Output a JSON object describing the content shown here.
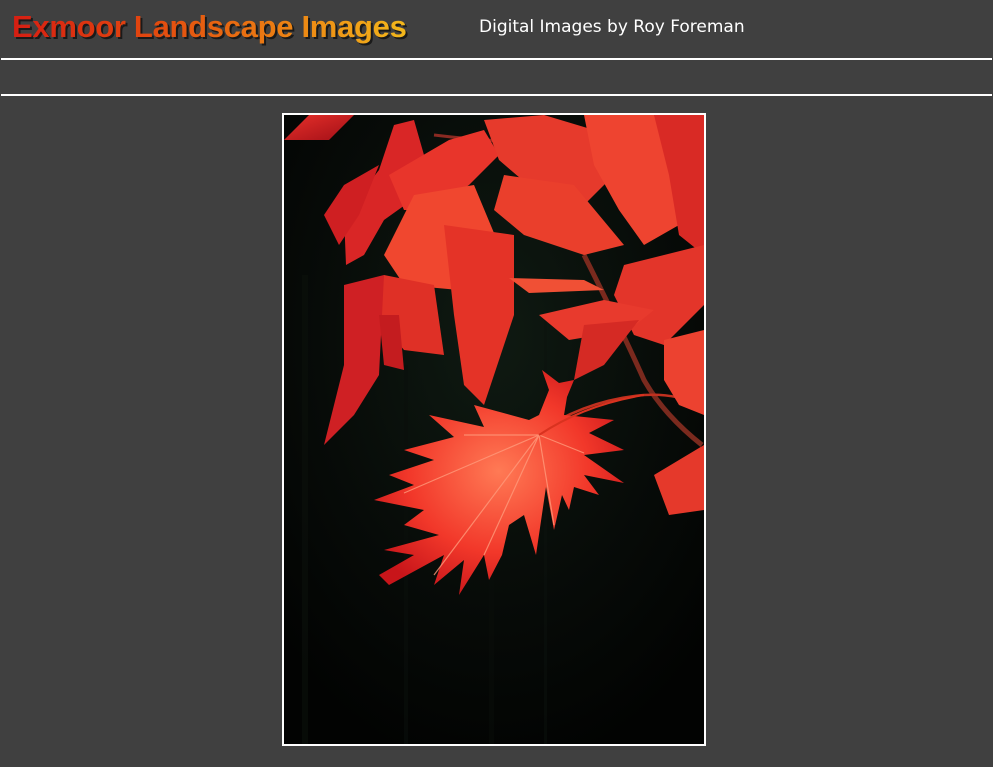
{
  "site": {
    "title": "Exmoor Landscape Images",
    "tagline": "Digital Images by Roy Foreman"
  },
  "colors": {
    "background": "#404040",
    "rule": "#ffffff",
    "tagline_text": "#ffffff",
    "logo_gradient_start": "#d61e12",
    "logo_gradient_end": "#f3b81b",
    "photo_frame": "#ffffff"
  },
  "main": {
    "photo": {
      "subject": "red autumn maple leaves backlit against dark background"
    }
  }
}
